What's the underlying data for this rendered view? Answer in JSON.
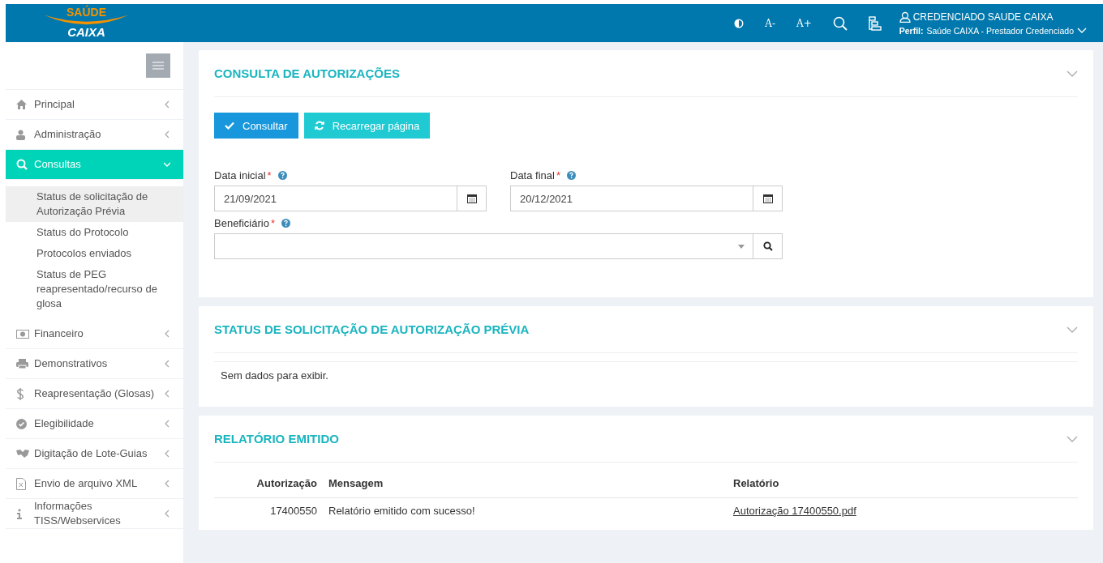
{
  "header": {
    "logo_top": "SAÚDE",
    "logo_bottom": "CAIXA",
    "tools": [
      {
        "kind": "contrast"
      },
      {
        "kind": "text",
        "label": "A-"
      },
      {
        "kind": "text",
        "label": "A+"
      },
      {
        "kind": "search"
      },
      {
        "kind": "sitemap"
      }
    ],
    "user": "CREDENCIADO SAUDE CAIXA",
    "profile_label": "Perfil:",
    "profile": "Saúde CAIXA - Prestador Credenciado"
  },
  "sidebar": {
    "items": [
      {
        "label": "Principal",
        "kind": "home",
        "expanded": false,
        "selected": false
      },
      {
        "label": "Administração",
        "kind": "user",
        "expanded": false,
        "selected": false
      },
      {
        "label": "Consultas",
        "kind": "search",
        "expanded": true,
        "selected": true,
        "children": [
          {
            "label": "Status de solicitação de Autorização Prévia",
            "selected": true
          },
          {
            "label": "Status do Protocolo",
            "selected": false
          },
          {
            "label": "Protocolos enviados",
            "selected": false
          },
          {
            "label": "Status de PEG reapresentado/recurso de glosa",
            "selected": false
          }
        ]
      },
      {
        "label": "Financeiro",
        "kind": "money",
        "expanded": false,
        "selected": false
      },
      {
        "label": "Demonstrativos",
        "kind": "print",
        "expanded": false,
        "selected": false
      },
      {
        "label": "Reapresentação (Glosas)",
        "kind": "dollar",
        "expanded": false,
        "selected": false
      },
      {
        "label": "Elegibilidade",
        "kind": "check",
        "expanded": false,
        "selected": false
      },
      {
        "label": "Digitação de Lote-Guias",
        "kind": "handshake",
        "expanded": false,
        "selected": false
      },
      {
        "label": "Envio de arquivo XML",
        "kind": "file",
        "expanded": false,
        "selected": false
      },
      {
        "label": "Informações TISS/Webservices",
        "kind": "info",
        "expanded": false,
        "selected": false
      }
    ]
  },
  "search_panel": {
    "title": "CONSULTA DE AUTORIZAÇÕES",
    "buttons": [
      {
        "label": "Consultar",
        "kind": "primary"
      },
      {
        "label": "Recarregar página",
        "kind": "reload"
      }
    ],
    "date_fields": [
      {
        "label": "Data inicial",
        "required_mark": "*",
        "value": "21/09/2021"
      },
      {
        "label": "Data final",
        "required_mark": "*",
        "value": "20/12/2021"
      }
    ],
    "beneficiary": {
      "label": "Beneficiário",
      "required_mark": "*"
    }
  },
  "status_panel": {
    "title": "STATUS DE SOLICITAÇÃO DE AUTORIZAÇÃO PRÉVIA",
    "empty_text": "Sem dados para exibir."
  },
  "report_panel": {
    "title": "RELATÓRIO EMITIDO",
    "columns": [
      "Autorização",
      "Mensagem",
      "Relatório"
    ],
    "rows": [
      {
        "authorization": "17400550",
        "message": "Relatório emitido com sucesso!",
        "report": "Autorização 17400550.pdf"
      }
    ]
  }
}
